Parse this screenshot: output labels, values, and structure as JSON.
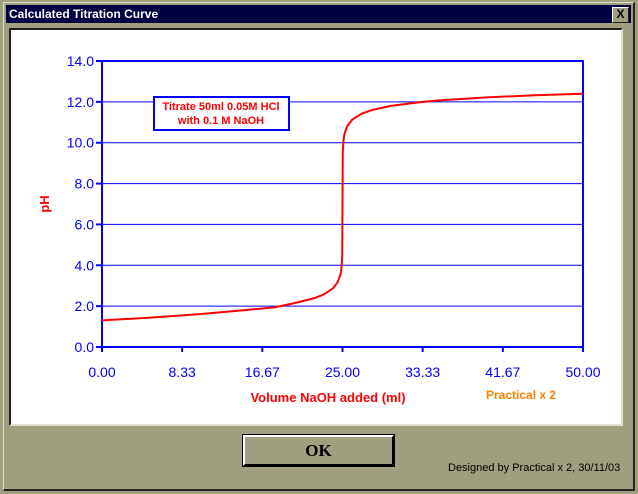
{
  "window": {
    "title": "Calculated Titration Curve",
    "close_label": "X"
  },
  "ok_label": "OK",
  "credit": "Designed by Practical x 2, 30/11/03",
  "watermark": "Practical x 2",
  "colors": {
    "axis": "#0000ff",
    "curve": "#ff0000",
    "label": "#ff0000",
    "watermark": "#ff8000",
    "titlebar": "#000040",
    "face": "#a0a080"
  },
  "chart_data": {
    "type": "line",
    "title": [
      "Titrate 50ml 0.05M HCl",
      "with 0.1 M NaOH"
    ],
    "xlabel": "Volume NaOH added (ml)",
    "ylabel": "pH",
    "xlim": [
      0,
      50
    ],
    "ylim": [
      0,
      14
    ],
    "xticks": [
      "0.00",
      "8.33",
      "16.67",
      "25.00",
      "33.33",
      "41.67",
      "50.00"
    ],
    "yticks": [
      "0.0",
      "2.0",
      "4.0",
      "6.0",
      "8.0",
      "10.0",
      "12.0",
      "14.0"
    ],
    "grid": "horizontal",
    "series": [
      {
        "name": "pH",
        "x": [
          0,
          5,
          10,
          15,
          18,
          20,
          22,
          23,
          24,
          24.5,
          24.8,
          24.9,
          24.97,
          25,
          25.03,
          25.1,
          25.2,
          25.5,
          26,
          27,
          28,
          30,
          33,
          35,
          40,
          45,
          50
        ],
        "y": [
          1.3,
          1.44,
          1.6,
          1.81,
          1.95,
          2.15,
          2.38,
          2.56,
          2.87,
          3.17,
          3.57,
          3.87,
          4.4,
          7.0,
          9.6,
          10.12,
          10.42,
          10.82,
          11.12,
          11.42,
          11.59,
          11.8,
          11.98,
          12.07,
          12.22,
          12.32,
          12.4
        ]
      }
    ]
  }
}
